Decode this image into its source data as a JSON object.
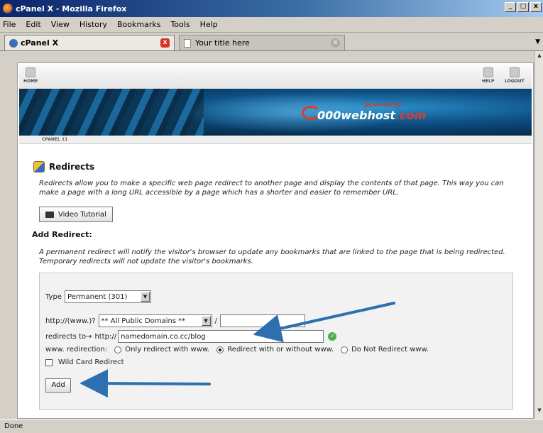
{
  "window": {
    "title": "cPanel X - Mozilla Firefox",
    "min": "_",
    "max": "□",
    "close": "x"
  },
  "menu": {
    "items": [
      "File",
      "Edit",
      "View",
      "History",
      "Bookmarks",
      "Tools",
      "Help"
    ]
  },
  "tabs": [
    {
      "label": "cPanel X",
      "close": "x"
    },
    {
      "label": "Your title here",
      "close": "x"
    }
  ],
  "nav": {
    "home": "HOME",
    "help": "HELP",
    "logout": "LOGOUT"
  },
  "banner": {
    "powered": "powered by",
    "brand_a": "000webhost",
    "brand_b": ".com"
  },
  "breadcrumb": "CPANEL 11",
  "page": {
    "title": "Redirects",
    "description": "Redirects allow you to make a specific web page redirect to another page and display the contents of that page. This way you can make a page with a long URL accessible by a page which has a shorter and easier to remember URL.",
    "video_button": "Video Tutorial",
    "add_title": "Add Redirect:",
    "add_description": "A permanent redirect will notify the visitor's browser to update any bookmarks that are linked to the page that is being redirected. Temporary redirects will not update the visitor's bookmarks."
  },
  "form": {
    "type_label": "Type",
    "type_value": "Permanent (301)",
    "url_label": "http://(www.)?",
    "domain_value": "** All Public Domains **",
    "slash": "/",
    "path_value": "",
    "redirects_to_label": "redirects to→",
    "http_prefix": "http://",
    "target_value": "namedomain.co.cc/blog",
    "www_label": "www. redirection:",
    "www_options": [
      "Only redirect with www.",
      "Redirect with or without www.",
      "Do Not Redirect www."
    ],
    "wildcard_label": "Wild Card Redirect",
    "add_button": "Add"
  },
  "status": "Done",
  "colors": {
    "annotation_arrow": "#2e6fb0",
    "title_bar": "#0a246a"
  }
}
